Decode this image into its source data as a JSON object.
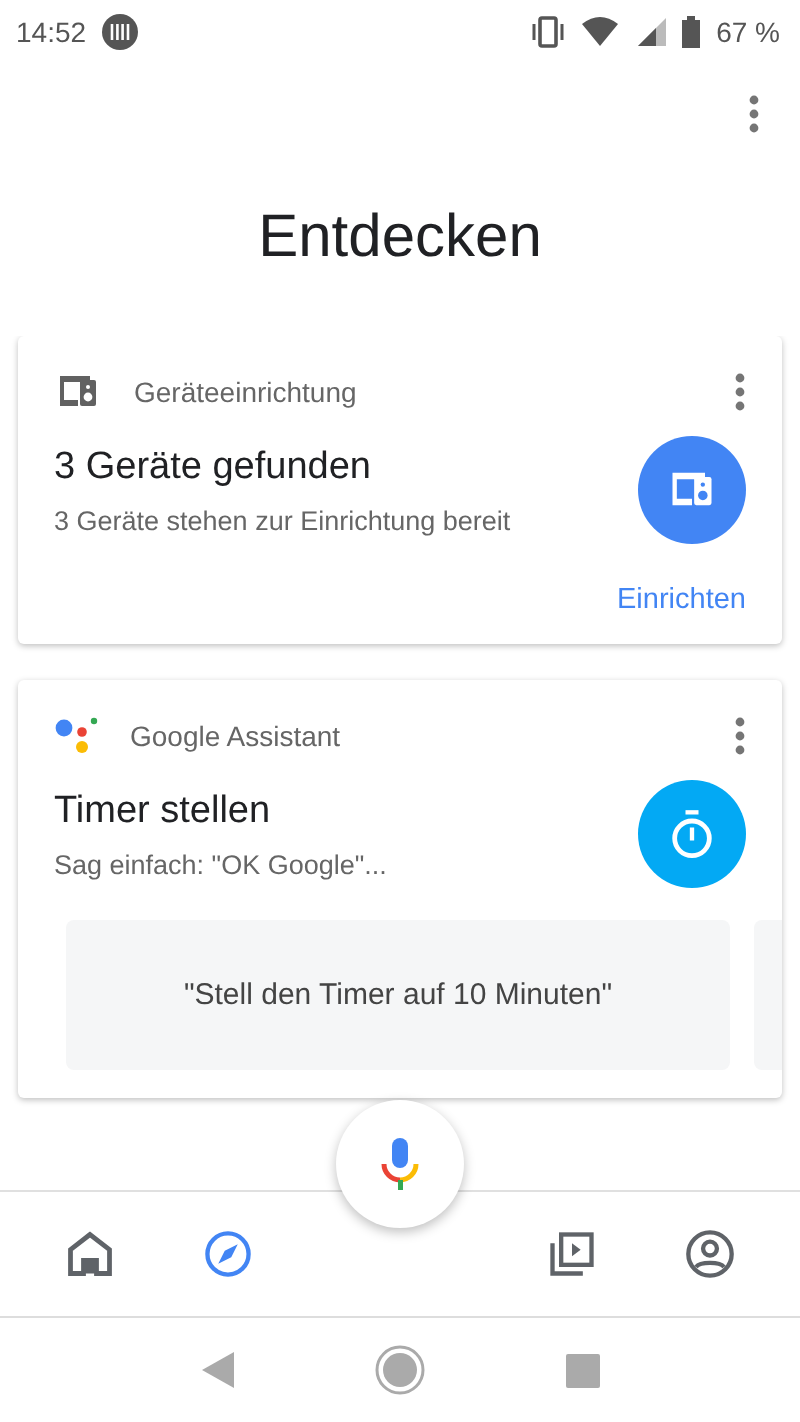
{
  "status_bar": {
    "time": "14:52",
    "battery": "67 %"
  },
  "title": "Entdecken",
  "cards": [
    {
      "kind": "devices",
      "category": "Geräteeinrichtung",
      "heading": "3 Geräte gefunden",
      "subtitle": "3 Geräte stehen zur Einrichtung bereit",
      "action": "Einrichten"
    },
    {
      "kind": "assistant",
      "category": "Google Assistant",
      "heading": "Timer stellen",
      "subtitle": "Sag einfach: \"OK Google\"...",
      "suggestions": [
        "\"Stell den Timer auf 10 Minuten\""
      ]
    }
  ],
  "bottom_nav": [
    {
      "kind": "home",
      "selected": false
    },
    {
      "kind": "explore",
      "selected": true
    },
    {
      "kind": "media",
      "selected": false
    },
    {
      "kind": "account",
      "selected": false
    }
  ]
}
